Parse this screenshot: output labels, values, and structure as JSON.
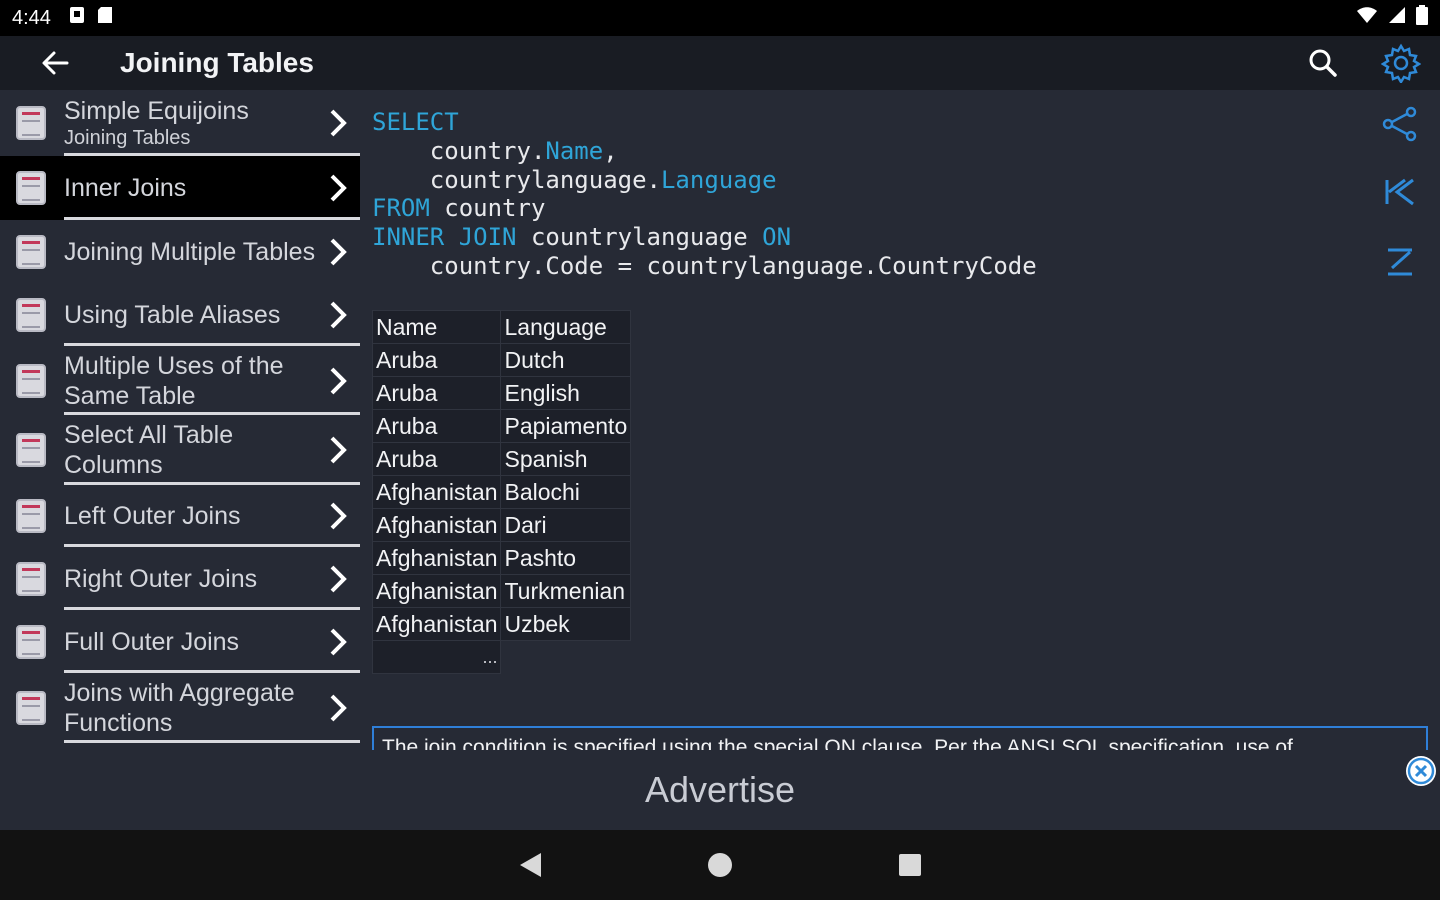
{
  "status": {
    "time": "4:44"
  },
  "appbar": {
    "title": "Joining Tables"
  },
  "sidebar": {
    "items": [
      {
        "label": "Simple Equijoins",
        "sub": "Joining Tables"
      },
      {
        "label": "Inner Joins"
      },
      {
        "label": "Joining Multiple Tables"
      },
      {
        "label": "Using Table Aliases"
      },
      {
        "label": "Multiple Uses of the Same Table"
      },
      {
        "label": "Select All Table Columns"
      },
      {
        "label": "Left Outer Joins"
      },
      {
        "label": "Right Outer Joins"
      },
      {
        "label": "Full Outer Joins"
      },
      {
        "label": "Joins with Aggregate Functions"
      }
    ]
  },
  "code": {
    "select": "SELECT",
    "indent": "    ",
    "country_prefix": "country.",
    "name_col": "Name",
    "comma": ",",
    "cl_prefix": "countrylanguage.",
    "language_col": "Language",
    "from_kw": "FROM",
    "from_table": " country",
    "inner_join_kw": "INNER JOIN",
    "join_table": " countrylanguage ",
    "on_kw": "ON",
    "condition": "country.Code = countrylanguage.CountryCode"
  },
  "results": {
    "headers": [
      "Name",
      "Language"
    ],
    "rows": [
      [
        "Aruba",
        "Dutch"
      ],
      [
        "Aruba",
        "English"
      ],
      [
        "Aruba",
        "Papiamento"
      ],
      [
        "Aruba",
        "Spanish"
      ],
      [
        "Afghanistan",
        "Balochi"
      ],
      [
        "Afghanistan",
        "Dari"
      ],
      [
        "Afghanistan",
        "Pashto"
      ],
      [
        "Afghanistan",
        "Turkmenian"
      ],
      [
        "Afghanistan",
        "Uzbek"
      ]
    ],
    "ellipsis": "..."
  },
  "description": "The join condition is specified using the special ON clause. Per the ANSI SQL specification, use of",
  "ad": {
    "label": "Advertise"
  },
  "colors": {
    "accent": "#2fa5d8",
    "active_item": "#000000",
    "background": "#262a35",
    "appbar": "#191c23"
  },
  "icons": {
    "back": "arrow-left-icon",
    "search": "search-icon",
    "settings": "gear-icon",
    "share": "share-icon",
    "first": "skip-to-start-icon",
    "sum": "sigma-icon"
  }
}
